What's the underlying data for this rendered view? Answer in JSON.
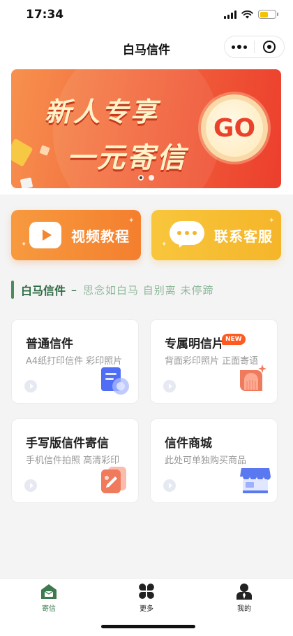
{
  "status_bar": {
    "time": "17:34"
  },
  "nav": {
    "title": "白马信件"
  },
  "banner": {
    "line1": "新人专享",
    "line2": "一元寄信",
    "go_label": "GO",
    "slide_count": 2,
    "active_slide": 1
  },
  "quick_actions": [
    {
      "label": "视频教程",
      "icon": "play-icon"
    },
    {
      "label": "联系客服",
      "icon": "chat-bubble-icon"
    }
  ],
  "slogan": {
    "title": "白马信件",
    "dash": "–",
    "text": "思念如白马 自别离 未停蹄"
  },
  "services": [
    {
      "title": "普通信件",
      "desc": "A4纸打印信件 彩印照片",
      "icon": "document-icon"
    },
    {
      "title": "专属明信片",
      "badge": "NEW",
      "desc": "背面彩印照片 正面寄语",
      "icon": "postcard-icon"
    },
    {
      "title": "手写版信件寄信",
      "desc": "手机信件拍照 高清彩印",
      "icon": "handwriting-icon"
    },
    {
      "title": "信件商城",
      "desc": "此处可单独购买商品",
      "icon": "shop-icon"
    }
  ],
  "tabs": [
    {
      "label": "寄信",
      "icon": "house-icon",
      "active": true
    },
    {
      "label": "更多",
      "icon": "clover-icon",
      "active": false
    },
    {
      "label": "我的",
      "icon": "user-icon",
      "active": false
    }
  ],
  "colors": {
    "brand_green": "#3d7a4f",
    "banner_red": "#ec3e2d",
    "video_orange": "#f47f2e",
    "service_yellow": "#f5b52a",
    "badge_orange": "#ff5a1f"
  }
}
